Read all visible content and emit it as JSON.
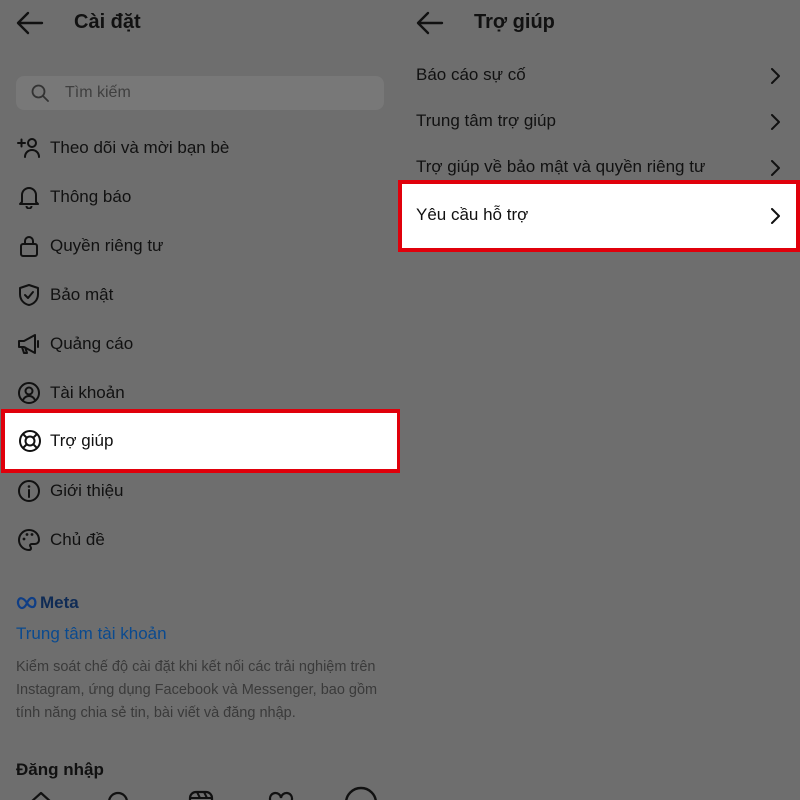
{
  "left": {
    "title": "Cài đặt",
    "search_placeholder": "Tìm kiếm",
    "menu": [
      {
        "label": "Theo dõi và mời bạn bè",
        "icon": "add-person-icon"
      },
      {
        "label": "Thông báo",
        "icon": "bell-icon"
      },
      {
        "label": "Quyền riêng tư",
        "icon": "lock-icon"
      },
      {
        "label": "Bảo mật",
        "icon": "shield-check-icon"
      },
      {
        "label": "Quảng cáo",
        "icon": "megaphone-icon"
      },
      {
        "label": "Tài khoản",
        "icon": "account-circle-icon"
      },
      {
        "label": "Trợ giúp",
        "icon": "lifebuoy-icon"
      },
      {
        "label": "Giới thiệu",
        "icon": "info-icon"
      },
      {
        "label": "Chủ đề",
        "icon": "palette-icon"
      }
    ],
    "meta_label": "Meta",
    "accounts_center": "Trung tâm tài khoản",
    "accounts_desc": "Kiểm soát chế độ cài đặt khi kết nối các trải nghiệm trên Instagram, ứng dụng Facebook và Messenger, bao gồm tính năng chia sẻ tin, bài viết và đăng nhập.",
    "login_heading": "Đăng nhập"
  },
  "right": {
    "title": "Trợ giúp",
    "items": [
      {
        "label": "Báo cáo sự cố"
      },
      {
        "label": "Trung tâm trợ giúp"
      },
      {
        "label": "Trợ giúp về bảo mật và quyền riêng tư"
      },
      {
        "label": "Yêu cầu hỗ trợ"
      }
    ]
  },
  "highlight_color": "#e0000b",
  "link_color": "#0a4a8f"
}
